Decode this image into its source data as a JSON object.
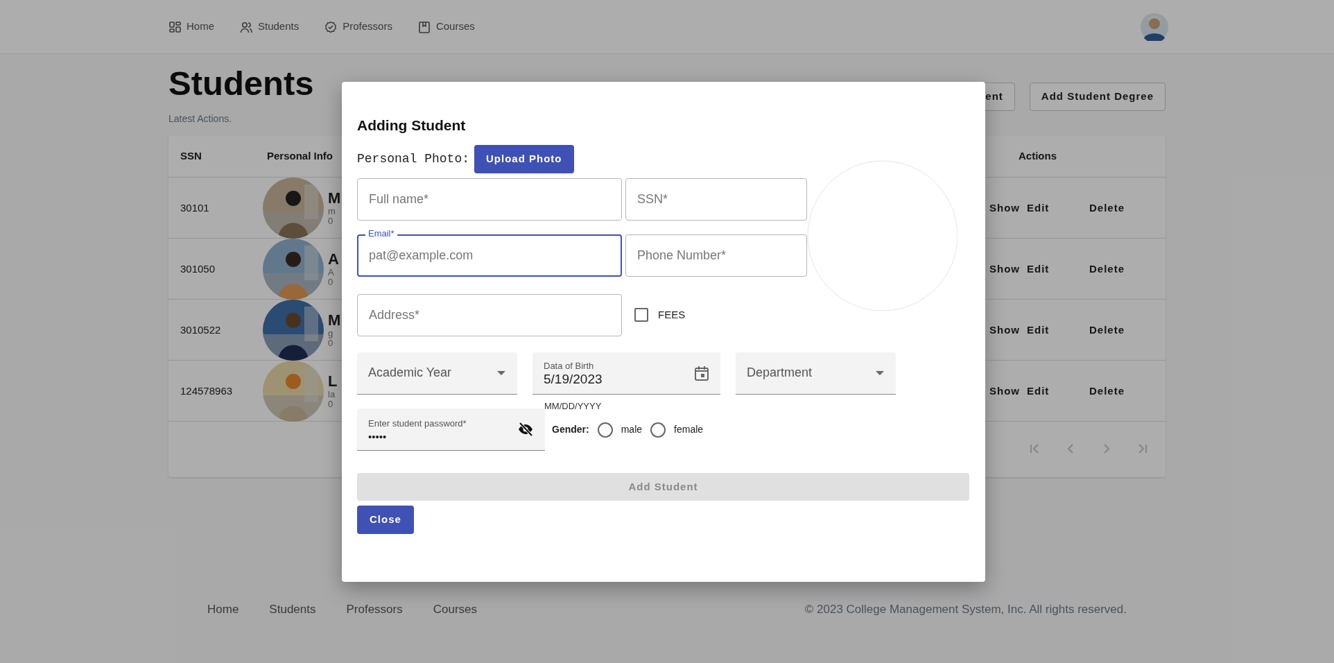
{
  "nav": {
    "items": [
      {
        "label": "Home"
      },
      {
        "label": "Students"
      },
      {
        "label": "Professors"
      },
      {
        "label": "Courses"
      }
    ]
  },
  "header": {
    "title": "Students",
    "subtitle": "Latest Actions.",
    "buttons": [
      "ent",
      "Add Student Degree"
    ]
  },
  "table": {
    "columns": [
      "SSN",
      "Personal Info",
      "Actions"
    ],
    "rows": [
      {
        "ssn": "30101",
        "name": "M",
        "line_2": "m",
        "line_3": "0",
        "actions": [
          "Show",
          "Edit",
          "Delete"
        ]
      },
      {
        "ssn": "301050",
        "name": "A",
        "line_2": "A",
        "line_3": "0",
        "actions": [
          "Show",
          "Edit",
          "Delete"
        ]
      },
      {
        "ssn": "3010522",
        "name": "M",
        "line_2": "g",
        "line_3": "0",
        "actions": [
          "Show",
          "Edit",
          "Delete"
        ]
      },
      {
        "ssn": "124578963",
        "name": "L",
        "line_2": "la",
        "line_3": "0",
        "actions": [
          "Show",
          "Edit",
          "Delete"
        ]
      }
    ],
    "pagination": {
      "disabled": true
    }
  },
  "dialog": {
    "title": "Adding Student",
    "photo_label": "Personal Photo:",
    "upload_button": "Upload Photo",
    "fields": [
      {
        "placeholder": "Full name*",
        "focused": false
      },
      {
        "placeholder": "SSN*",
        "focused": false
      },
      {
        "label": "Email*",
        "placeholder": "pat@example.com",
        "focused": true
      },
      {
        "placeholder": "Phone Number*",
        "focused": false
      },
      {
        "placeholder": "Address*",
        "focused": false
      }
    ],
    "fees": {
      "label": "FEES",
      "checked": false
    },
    "academic_year": {
      "label": "Academic Year"
    },
    "date_of_birth": {
      "label": "Data of Birth",
      "value": "5/19/2023",
      "helper": "MM/DD/YYYY"
    },
    "department": {
      "label": "Department"
    },
    "password": {
      "label": "Enter student password*",
      "value": "•••••"
    },
    "gender": {
      "label": "Gender:",
      "options": [
        {
          "label": "male",
          "selected": false
        },
        {
          "label": "female",
          "selected": false
        }
      ]
    },
    "submit": {
      "label": "Add Student",
      "disabled": true
    },
    "close": "Close"
  },
  "footer": {
    "links": [
      "Home",
      "Students",
      "Professors",
      "Courses"
    ],
    "copyright": "© 2023 College Management System, Inc. All rights reserved."
  }
}
